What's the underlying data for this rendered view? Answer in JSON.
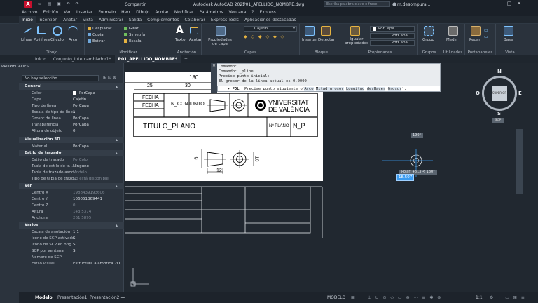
{
  "title": {
    "app_title": "Autodesk AutoCAD 2025",
    "file_title": "P01_APELLIDO_NOMBRE.dwg",
    "share_label": "Compartir",
    "search_placeholder": "Escriba palabra clave o frase",
    "user": "m.desompura..."
  },
  "menu": [
    "Archivo",
    "Edición",
    "Ver",
    "Insertar",
    "Formato",
    "Herr",
    "Dibujo",
    "Acotar",
    "Modificar",
    "Parámetros",
    "Ventana",
    "?",
    "Express"
  ],
  "ribbon_tabs": [
    "Inicio",
    "Inserción",
    "Anotar",
    "Vista",
    "Administrar",
    "Salida",
    "Complementos",
    "Colaborar",
    "Express Tools",
    "Aplicaciones destacadas"
  ],
  "ribbon": {
    "draw": {
      "label": "Dibujo",
      "linea": "Línea",
      "polilinea": "Polilínea",
      "circulo": "Círculo",
      "arco": "Arco"
    },
    "modify": {
      "label": "Modificar",
      "desplazar": "Desplazar",
      "girar": "Girar",
      "copiar": "Copiar",
      "simetria": "Simetría",
      "estirar": "Estirar",
      "escala": "Escala"
    },
    "annotation": {
      "label": "Anotación",
      "texto": "Texto",
      "acotar": "Acotar"
    },
    "layers": {
      "label": "Capas",
      "props_label": "Propiedades de capa",
      "current_layer": "Cajetin"
    },
    "block": {
      "label": "Bloque",
      "insertar": "Insertar",
      "detectar": "Detectar"
    },
    "properties": {
      "label": "Propiedades",
      "igualar": "Igualar propiedades",
      "porcapa": "PorCapa"
    },
    "groups": {
      "label": "Grupos",
      "grupo": "Grupo"
    },
    "utilities": {
      "label": "Utilidades",
      "medir": "Medir"
    },
    "clipboard": {
      "label": "Portapapeles",
      "pegar": "Pegar"
    },
    "view": {
      "label": "Vista",
      "base": "Base"
    }
  },
  "file_tabs": [
    "Inicio",
    "Conjunto_Intercambiador1*",
    "P01_APELLIDO_NOMBRE*"
  ],
  "properties_panel": {
    "title": "PROPIEDADES",
    "selection": "No hay selección",
    "sections": {
      "general": {
        "title": "General",
        "rows": [
          {
            "k": "Color",
            "v": "PorCapa"
          },
          {
            "k": "Capa",
            "v": "Cajetin"
          },
          {
            "k": "Tipo de línea",
            "v": "PorCapa"
          },
          {
            "k": "Escala de tipo de línea",
            "v": "1"
          },
          {
            "k": "Grosor de línea",
            "v": "PorCapa"
          },
          {
            "k": "Transparencia",
            "v": "PorCapa"
          },
          {
            "k": "Altura de objeto",
            "v": "0"
          }
        ]
      },
      "visual3d": {
        "title": "Visualización 3D",
        "rows": [
          {
            "k": "Material",
            "v": "PorCapa"
          }
        ]
      },
      "plotstyle": {
        "title": "Estilo de trazado",
        "rows": [
          {
            "k": "Estilo de trazado",
            "v": "PorColor"
          },
          {
            "k": "Tabla de estilo de tr...",
            "v": "Ninguno"
          },
          {
            "k": "Tabla de trazado asoc...",
            "v": "Modelo"
          },
          {
            "k": "Tipo de tabla de trazo...",
            "v": "No está disponible"
          }
        ]
      },
      "view": {
        "title": "Ver",
        "rows": [
          {
            "k": "Centro X",
            "v": "1988439193606"
          },
          {
            "k": "Centro Y",
            "v": "106051369441"
          },
          {
            "k": "Centro Z",
            "v": "0"
          },
          {
            "k": "Altura",
            "v": "143.5374"
          },
          {
            "k": "Anchura",
            "v": "261.5895"
          }
        ]
      },
      "misc": {
        "title": "Varios",
        "rows": [
          {
            "k": "Escala de anotación",
            "v": "1:1"
          },
          {
            "k": "Icono de SCP activado",
            "v": "Sí"
          },
          {
            "k": "Icono de SCP en orig...",
            "v": "Sí"
          },
          {
            "k": "SCP por ventana",
            "v": "Sí"
          },
          {
            "k": "Nombre de SCP",
            "v": ""
          },
          {
            "k": "Estilo visual",
            "v": "Estructura alámbrica 2D"
          }
        ]
      }
    }
  },
  "command": {
    "lines": [
      "Comando:",
      "Comando: _pline",
      "Precise punto inicial:",
      "El grosor de la línea actual es 0.0000"
    ],
    "prompt_prefix": "POL",
    "prompt_text": "Precise punto siguiente o",
    "options": [
      "Arco",
      "Mitad grosor",
      "Longitud",
      "desHacer",
      "Grosor"
    ]
  },
  "drawing": {
    "dim_180": "180",
    "dim_25": "25",
    "dim_30": "30",
    "fecha1": "FECHA",
    "fecha2": "FECHA",
    "n_conjunto": "N_CONJUNTO",
    "titulo": "TITULO_PLANO",
    "n_plano_label": "Nº PLANO",
    "n_p": "N_P",
    "university_line1": "VNIVERSITAT",
    "university_line2": "DE VALÈNCIA",
    "dim_6": "6",
    "dim_12": "12",
    "dim_10": "10"
  },
  "canvas_overlay": {
    "angle_tip": "190°",
    "polar_tip": "Polar: 4813 < 180°",
    "input_value": "18.507"
  },
  "viewcube": {
    "n": "N",
    "s": "S",
    "e": "E",
    "o": "O",
    "face": "SUPERIOR",
    "scp": "SCP"
  },
  "layouts": [
    "Modelo",
    "Presentación1",
    "Presentación2"
  ],
  "status": {
    "mode": "MODELO",
    "scale": "1:1"
  },
  "colors": {
    "accent": "#c8102e",
    "canvas_bg": "#212830",
    "sheet": "#ffffff",
    "cursor": "#3a9bf0"
  }
}
